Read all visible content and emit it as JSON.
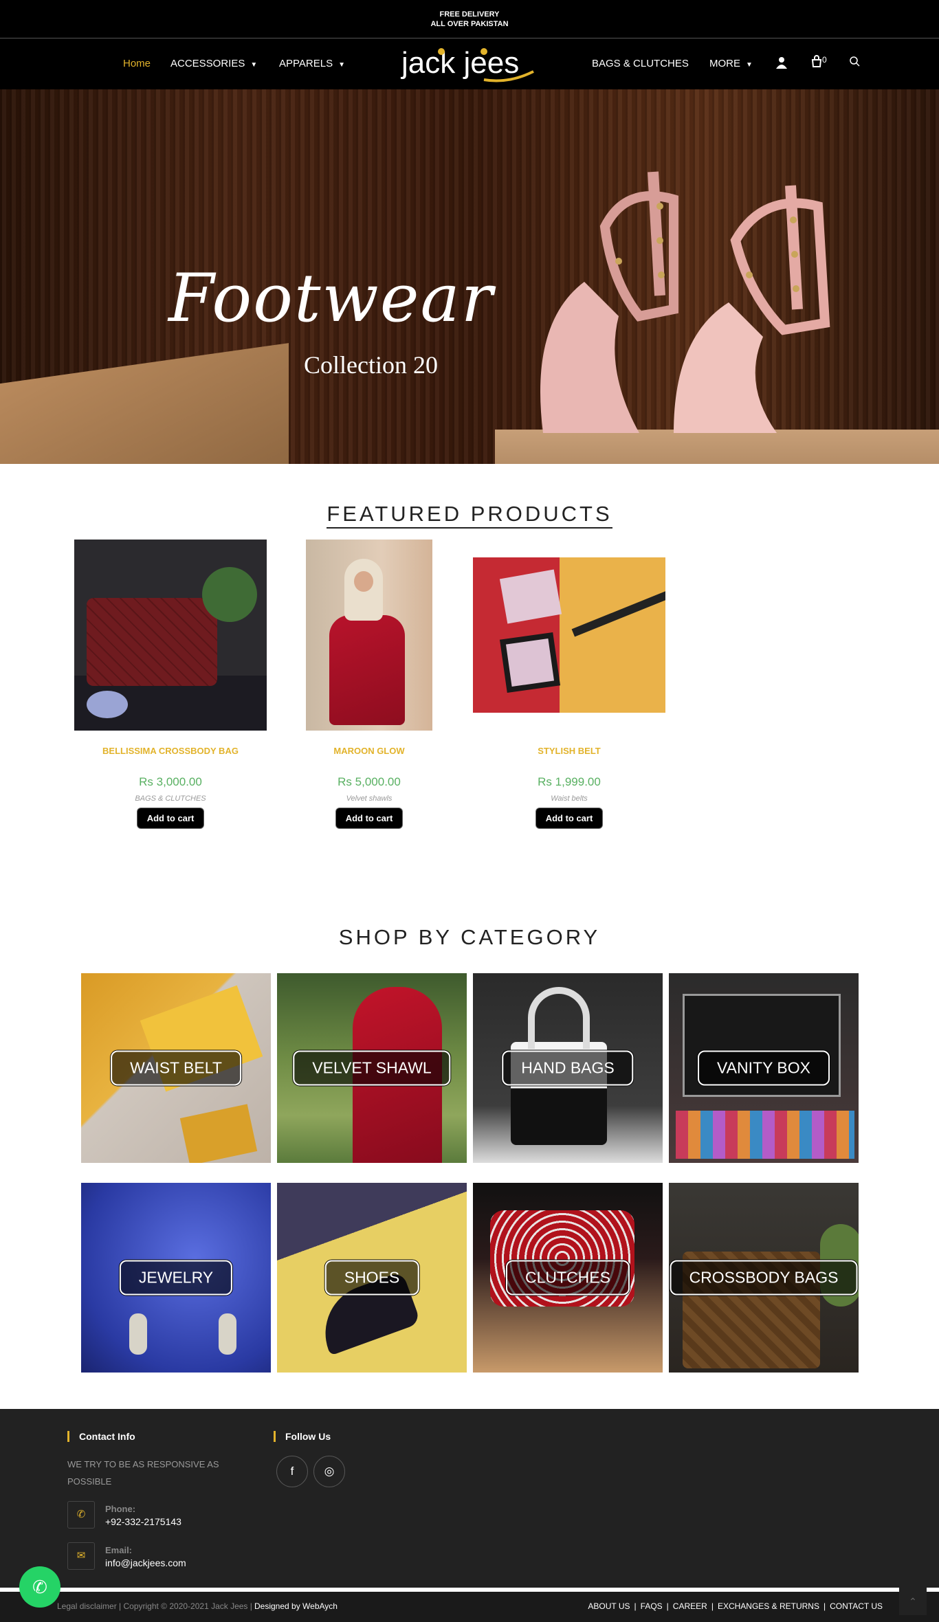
{
  "topbar": {
    "line1": "FREE DELIVERY",
    "line2": "ALL OVER PAKISTAN"
  },
  "nav": {
    "home": "Home",
    "accessories": "ACCESSORIES",
    "apparels": "APPARELS",
    "bags": "BAGS & CLUTCHES",
    "more": "MORE",
    "cart_count": "0",
    "logo_text": "jack jees",
    "active_color": "#e2b32b"
  },
  "hero": {
    "script": "Footwear",
    "sub": "Collection 20"
  },
  "featured": {
    "title": "FEATURED PRODUCTS",
    "products": [
      {
        "name": "BELLISSIMA CROSSBODY BAG",
        "price": "Rs 3,000.00",
        "category": "BAGS & CLUTCHES",
        "button": "Add to cart"
      },
      {
        "name": "MAROON GLOW",
        "price": "Rs 5,000.00",
        "category": "Velvet shawls",
        "button": "Add to cart"
      },
      {
        "name": "STYLISH BELT",
        "price": "Rs 1,999.00",
        "category": "Waist belts",
        "button": "Add to cart"
      }
    ]
  },
  "categories": {
    "title": "SHOP BY CATEGORY",
    "items": [
      {
        "label": "WAIST BELT"
      },
      {
        "label": "VELVET SHAWL"
      },
      {
        "label": "HAND BAGS"
      },
      {
        "label": "VANITY BOX"
      },
      {
        "label": "JEWELRY"
      },
      {
        "label": "SHOES"
      },
      {
        "label": "CLUTCHES"
      },
      {
        "label": "CROSSBODY BAGS"
      }
    ]
  },
  "footer": {
    "contact_title": "Contact Info",
    "contact_text": "WE TRY TO BE AS RESPONSIVE AS POSSIBLE",
    "phone_label": "Phone:",
    "phone": "+92-332-2175143",
    "email_label": "Email:",
    "email": "info@jackjees.com",
    "follow_title": "Follow Us",
    "copyright": "Legal disclaimer | Copyright © 2020-2021 Jack Jees |",
    "designer": "Designed by WebAych",
    "links": [
      "ABOUT US",
      "FAQS",
      "CAREER",
      "EXCHANGES & RETURNS",
      "CONTACT US"
    ]
  }
}
